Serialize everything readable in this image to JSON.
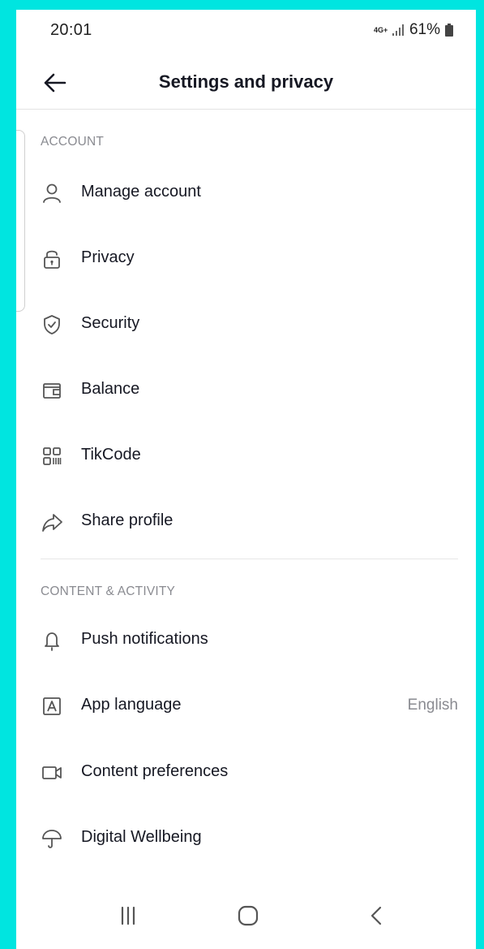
{
  "status_bar": {
    "time": "20:01",
    "network": "4G+",
    "battery": "61%"
  },
  "header": {
    "title": "Settings and privacy",
    "back_icon": "arrow-left-icon"
  },
  "account": {
    "heading": "ACCOUNT",
    "items": [
      {
        "label": "Manage account",
        "icon": "person-icon"
      },
      {
        "label": "Privacy",
        "icon": "lock-icon"
      },
      {
        "label": "Security",
        "icon": "shield-icon"
      },
      {
        "label": "Balance",
        "icon": "wallet-icon"
      },
      {
        "label": "TikCode",
        "icon": "qr-code-icon"
      },
      {
        "label": "Share profile",
        "icon": "share-icon"
      }
    ]
  },
  "content_activity": {
    "heading": "CONTENT & ACTIVITY",
    "items": [
      {
        "label": "Push notifications",
        "icon": "bell-icon"
      },
      {
        "label": "App language",
        "icon": "language-icon",
        "value": "English"
      },
      {
        "label": "Content preferences",
        "icon": "video-icon"
      },
      {
        "label": "Digital Wellbeing",
        "icon": "umbrella-icon"
      }
    ]
  },
  "nav_bar": {
    "recent": "recent-apps-icon",
    "home": "home-icon",
    "back": "back-icon"
  },
  "colors": {
    "frame_border": "#00e5e0",
    "text_primary": "#161823",
    "text_secondary": "#8a8b91"
  }
}
